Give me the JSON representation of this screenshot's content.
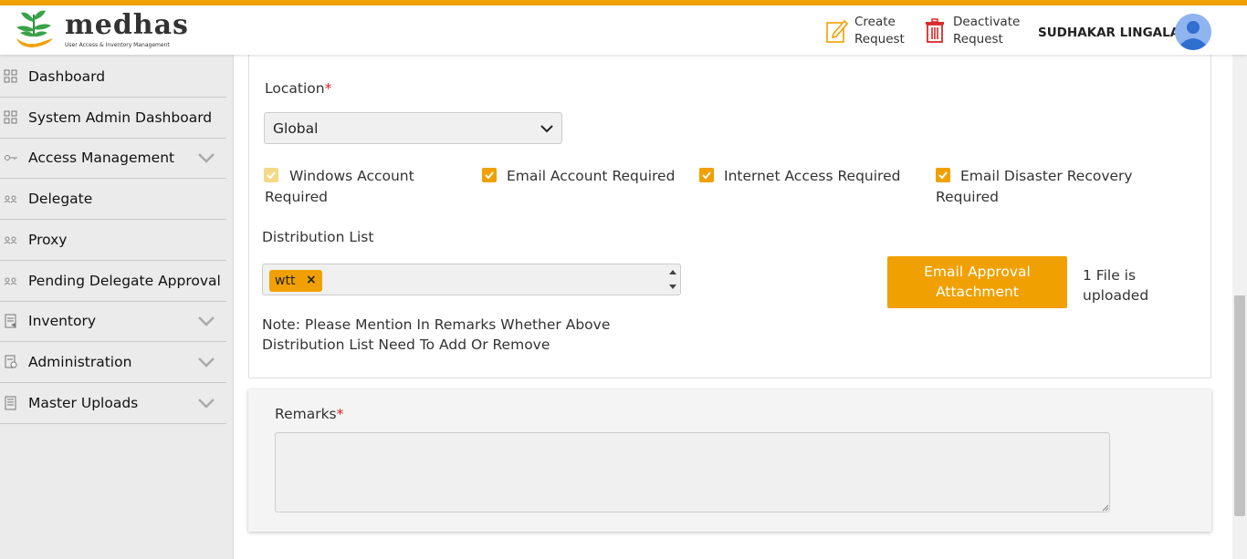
{
  "colors": {
    "accent": "#f0a000",
    "required": "#e02020",
    "sidebar_bg": "#ebebeb"
  },
  "brand": {
    "name": "medhas",
    "tagline": "User Access & Inventory Management"
  },
  "header": {
    "create_label_1": "Create",
    "create_label_2": "Request",
    "deactivate_label_1": "Deactivate",
    "deactivate_label_2": "Request",
    "user_name": "SUDHAKAR LINGALA"
  },
  "sidebar": {
    "items": [
      {
        "label": "Dashboard",
        "icon": "grid-icon",
        "expandable": false
      },
      {
        "label": "System Admin Dashboard",
        "icon": "grid-icon",
        "expandable": false
      },
      {
        "label": "Access Management",
        "icon": "key-icon",
        "expandable": true
      },
      {
        "label": "Delegate",
        "icon": "users-icon",
        "expandable": false
      },
      {
        "label": "Proxy",
        "icon": "users-icon",
        "expandable": false
      },
      {
        "label": "Pending Delegate Approval",
        "icon": "users-icon",
        "expandable": false
      },
      {
        "label": "Inventory",
        "icon": "clipboard-icon",
        "expandable": true
      },
      {
        "label": "Administration",
        "icon": "settings-doc-icon",
        "expandable": true
      },
      {
        "label": "Master Uploads",
        "icon": "document-icon",
        "expandable": true
      }
    ]
  },
  "form": {
    "location_label": "Location",
    "required_mark": "*",
    "location_value": "Global",
    "checkboxes": [
      {
        "label": "Windows Account Required",
        "checked": true,
        "disabled": true
      },
      {
        "label": "Email Account Required",
        "checked": true,
        "disabled": false
      },
      {
        "label": "Internet Access Required",
        "checked": true,
        "disabled": false
      },
      {
        "label": "Email Disaster Recovery Required",
        "checked": true,
        "disabled": false
      }
    ],
    "distribution_label": "Distribution List",
    "distribution_tags": [
      "wtt"
    ],
    "tag_remove": "×",
    "approval_button": "Email Approval Attachment",
    "upload_status": "1 File is uploaded",
    "note": "Note: Please Mention In Remarks Whether Above Distribution List Need To Add Or Remove",
    "remarks_label": "Remarks",
    "remarks_value": ""
  }
}
